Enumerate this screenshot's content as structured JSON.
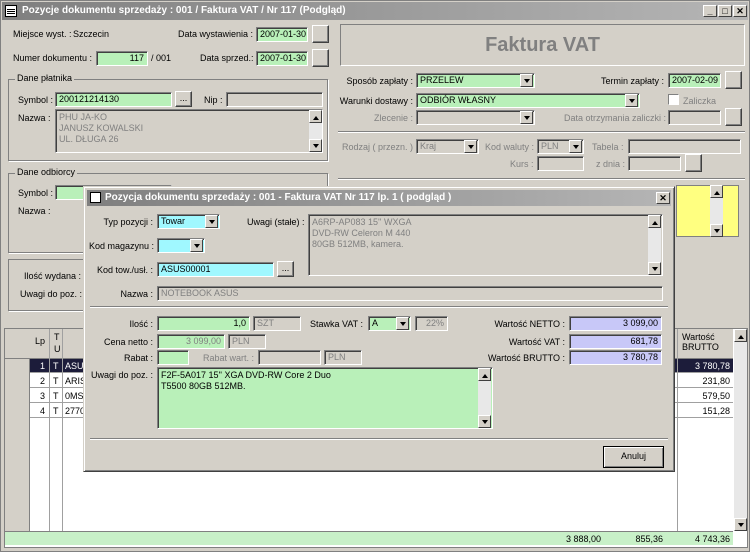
{
  "window": {
    "title": "Pozycje dokumentu sprzedaży : 001 / Faktura VAT / Nr 117  (Podgląd)"
  },
  "header": {
    "miejsce_label": "Miejsce wyst. :",
    "miejsce_value": "Szczecin",
    "numer_label": "Numer dokumentu :",
    "numer_value": "117",
    "numer_suffix": "/ 001",
    "data_wyst_label": "Data wystawienia :",
    "data_wyst_value": "2007-01-30",
    "data_sprzed_label": "Data sprzed.:",
    "data_sprzed_value": "2007-01-30",
    "doc_type": "Faktura VAT"
  },
  "platnik": {
    "group": "Dane płatnika",
    "symbol_label": "Symbol :",
    "symbol_value": "200121214130",
    "nip_label": "Nip :",
    "nip_value": "",
    "nazwa_label": "Nazwa :",
    "nazwa_lines": [
      "PHU JA-KO",
      "JANUSZ KOWALSKI",
      "UL. DŁUGA 26"
    ]
  },
  "odbiorca": {
    "group": "Dane odbiorcy",
    "symbol_label": "Symbol :",
    "nazwa_label": "Nazwa :"
  },
  "payment": {
    "sposob_label": "Sposób zapłaty :",
    "sposob_value": "PRZELEW",
    "termin_label": "Termin zapłaty :",
    "termin_value": "2007-02-09",
    "warunki_label": "Warunki dostawy :",
    "warunki_value": "ODBIÓR WŁASNY",
    "zaliczka_label": "Zaliczka",
    "zlecenie_label": "Zlecenie :",
    "data_zaliczki_label": "Data otrzymania zaliczki :",
    "rodzaj_label": "Rodzaj ( przezn. ) :",
    "rodzaj_value": "Kraj",
    "kod_waluty_label": "Kod waluty :",
    "kod_waluty_value": "PLN",
    "tabela_label": "Tabela :",
    "kurs_label": "Kurs :",
    "z_dnia_label": "z dnia :"
  },
  "bottom": {
    "ilosc_wydana_label": "Ilość wydana :",
    "uwagi_label": "Uwagi do poz. :"
  },
  "grid": {
    "col_lp": "Lp",
    "col_t": "T",
    "col_u": "U",
    "col_brutto": "Wartość BRUTTO",
    "rows": [
      {
        "lp": "1",
        "t": "T",
        "sym": "ASU",
        "brutto": "3 780,78"
      },
      {
        "lp": "2",
        "t": "T",
        "sym": "ARIS",
        "brutto": "231,80"
      },
      {
        "lp": "3",
        "t": "T",
        "sym": "0MS",
        "brutto": "579,50"
      },
      {
        "lp": "4",
        "t": "T",
        "sym": "2770",
        "brutto": "151,28"
      }
    ],
    "total_netto": "3 888,00",
    "total_vat": "855,36",
    "total_brutto": "4 743,36"
  },
  "dialog": {
    "title": "Pozycja dokumentu sprzedaży : 001 - Faktura VAT Nr 117 lp. 1 ( podgląd )",
    "typ_label": "Typ pozycji :",
    "typ_value": "Towar",
    "uwagi_stale_label": "Uwagi (stałe) :",
    "uwagi_stale_lines": [
      "A6RP-AP083 15'' WXGA",
      "DVD-RW Celeron M 440",
      "80GB 512MB, kamera."
    ],
    "kod_mag_label": "Kod magazynu :",
    "kod_mag_value": "",
    "kod_tow_label": "Kod tow./usł. :",
    "kod_tow_value": "ASUS00001",
    "nazwa_label": "Nazwa :",
    "nazwa_value": "NOTEBOOK ASUS",
    "ilosc_label": "Ilość :",
    "ilosc_value": "1,0",
    "jm_value": "SZT",
    "stawka_label": "Stawka VAT :",
    "stawka_value": "A",
    "stawka_pct": "22%",
    "wartosc_netto_label": "Wartość NETTO :",
    "wartosc_netto_value": "3 099,00",
    "cena_label": "Cena netto :",
    "cena_value": "3 099,00",
    "cena_waluta": "PLN",
    "wartosc_vat_label": "Wartość VAT :",
    "wartosc_vat_value": "681,78",
    "rabat_label": "Rabat :",
    "rabat_value": "",
    "rabat_wart_label": "Rabat wart. :",
    "rabat_wart_waluta": "PLN",
    "wartosc_brutto_label": "Wartość BRUTTO :",
    "wartosc_brutto_value": "3 780,78",
    "uwagi_poz_label": "Uwagi do poz. :",
    "uwagi_poz_lines": [
      "F2F-5A017 15'' XGA DVD-RW Core 2 Duo",
      "T5500 80GB 512MB."
    ],
    "cancel_label": "Anuluj"
  },
  "colors": {
    "green_field": "#b9f0b9",
    "cyan_field": "#a0f8ff",
    "blue_field": "#c8c8f8",
    "yellow_panel": "#ffff80",
    "selected_row": "#202040"
  }
}
